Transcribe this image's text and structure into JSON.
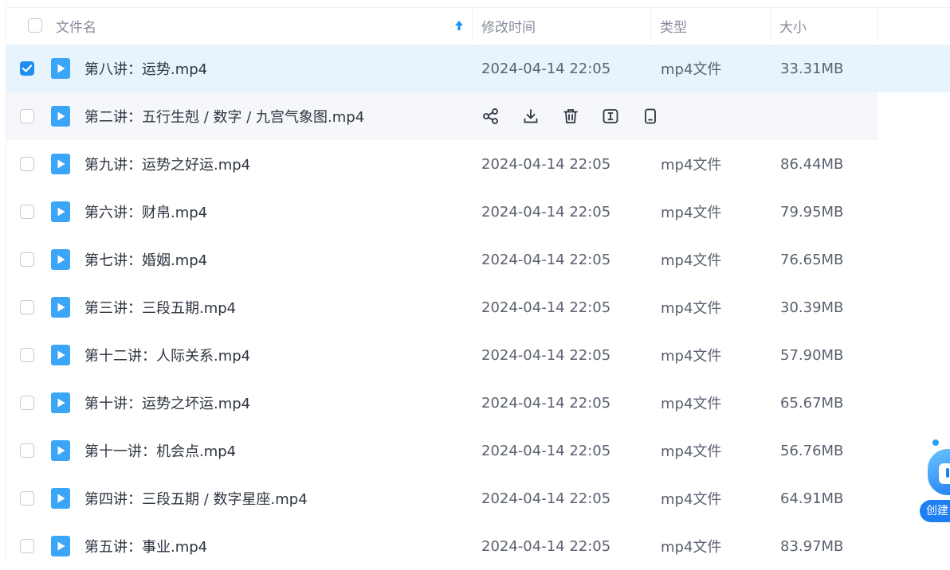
{
  "header": {
    "name": "文件名",
    "modified": "修改时间",
    "type": "类型",
    "size": "大小"
  },
  "rows": [
    {
      "name": "第八讲：运势.mp4",
      "time": "2024-04-14 22:05",
      "type": "mp4文件",
      "size": "33.31MB",
      "checked": true
    },
    {
      "name": "第二讲：五行生剋 / 数字 / 九宫气象图.mp4",
      "time": "",
      "type": "",
      "size": "",
      "hovered": true
    },
    {
      "name": "第九讲：运势之好运.mp4",
      "time": "2024-04-14 22:05",
      "type": "mp4文件",
      "size": "86.44MB"
    },
    {
      "name": "第六讲：财帛.mp4",
      "time": "2024-04-14 22:05",
      "type": "mp4文件",
      "size": "79.95MB"
    },
    {
      "name": "第七讲：婚姻.mp4",
      "time": "2024-04-14 22:05",
      "type": "mp4文件",
      "size": "76.65MB"
    },
    {
      "name": "第三讲：三段五期.mp4",
      "time": "2024-04-14 22:05",
      "type": "mp4文件",
      "size": "30.39MB"
    },
    {
      "name": "第十二讲：人际关系.mp4",
      "time": "2024-04-14 22:05",
      "type": "mp4文件",
      "size": "57.90MB"
    },
    {
      "name": "第十讲：运势之坏运.mp4",
      "time": "2024-04-14 22:05",
      "type": "mp4文件",
      "size": "65.67MB"
    },
    {
      "name": "第十一讲：机会点.mp4",
      "time": "2024-04-14 22:05",
      "type": "mp4文件",
      "size": "56.76MB"
    },
    {
      "name": "第四讲：三段五期 / 数字星座.mp4",
      "time": "2024-04-14 22:05",
      "type": "mp4文件",
      "size": "64.91MB"
    },
    {
      "name": "第五讲：事业.mp4",
      "time": "2024-04-14 22:05",
      "type": "mp4文件",
      "size": "83.97MB"
    }
  ],
  "hover_actions": [
    "share-icon",
    "download-icon",
    "delete-icon",
    "rename-icon",
    "mobile-icon"
  ],
  "float_widget": {
    "label": "创建"
  },
  "colors": {
    "accent": "#1e8ff0",
    "selected_row": "#e8f4fd",
    "hover_row": "#f6f7fa"
  }
}
